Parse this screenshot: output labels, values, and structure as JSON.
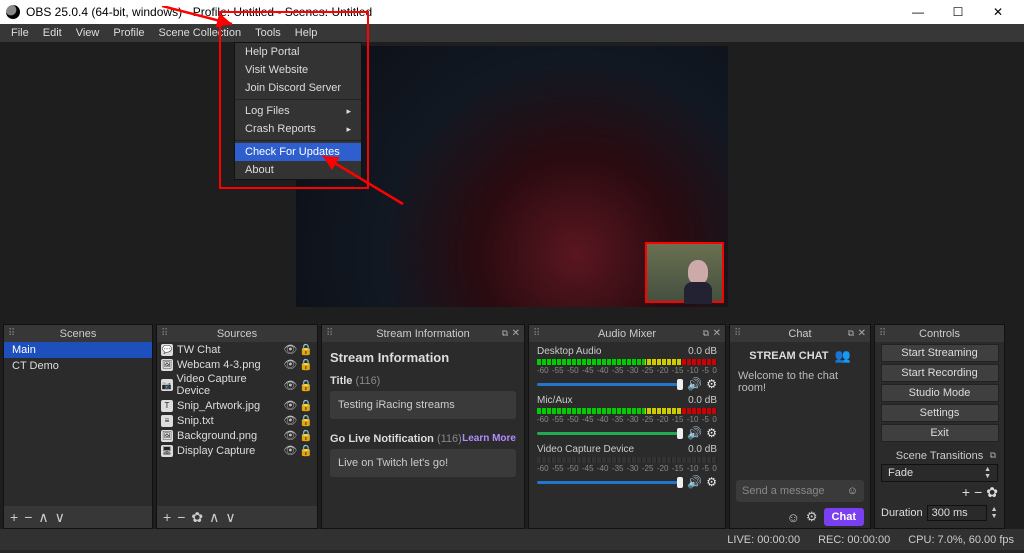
{
  "title": "OBS 25.0.4 (64-bit, windows) - Profile: Untitled - Scenes: Untitled",
  "menus": [
    "File",
    "Edit",
    "View",
    "Profile",
    "Scene Collection",
    "Tools",
    "Help"
  ],
  "help_menu": {
    "items": [
      {
        "label": "Help Portal",
        "sub": false
      },
      {
        "label": "Visit Website",
        "sub": false
      },
      {
        "label": "Join Discord Server",
        "sub": false
      },
      {
        "sep": true
      },
      {
        "label": "Log Files",
        "sub": true
      },
      {
        "label": "Crash Reports",
        "sub": true
      },
      {
        "sep": true
      },
      {
        "label": "Check For Updates",
        "sub": false,
        "highlight": true
      },
      {
        "label": "About",
        "sub": false
      }
    ]
  },
  "docks": {
    "scenes": "Scenes",
    "sources": "Sources",
    "stream_info": "Stream Information",
    "mixer": "Audio Mixer",
    "chat": "Chat",
    "controls": "Controls",
    "transitions": "Scene Transitions"
  },
  "scenes": [
    "Main",
    "CT Demo"
  ],
  "sources": [
    {
      "ico": "💬",
      "name": "TW Chat"
    },
    {
      "ico": "🖼",
      "name": "Webcam 4-3.png"
    },
    {
      "ico": "📷",
      "name": "Video Capture Device"
    },
    {
      "ico": "T",
      "name": "Snip_Artwork.jpg"
    },
    {
      "ico": "≡",
      "name": "Snip.txt"
    },
    {
      "ico": "🖼",
      "name": "Background.png"
    },
    {
      "ico": "🖥",
      "name": "Display Capture"
    }
  ],
  "stream_info": {
    "heading": "Stream Information",
    "title_label": "Title",
    "title_count": "(116)",
    "title_value": "Testing iRacing streams",
    "golive_label": "Go Live Notification",
    "golive_count": "(116)",
    "learn": "Learn More",
    "golive_value": "Live on Twitch let's go!"
  },
  "mixer": {
    "ch": [
      {
        "name": "Desktop Audio",
        "db": "0.0 dB",
        "slider": "blue"
      },
      {
        "name": "Mic/Aux",
        "db": "0.0 dB",
        "slider": "green"
      },
      {
        "name": "Video Capture Device",
        "db": "0.0 dB",
        "slider": "blue"
      }
    ],
    "ticks": [
      "-60",
      "-55",
      "-50",
      "-45",
      "-40",
      "-35",
      "-30",
      "-25",
      "-20",
      "-15",
      "-10",
      "-5",
      "0"
    ]
  },
  "chat": {
    "header": "STREAM CHAT",
    "welcome": "Welcome to the chat room!",
    "placeholder": "Send a message",
    "send": "Chat"
  },
  "controls": {
    "buttons": [
      "Start Streaming",
      "Start Recording",
      "Studio Mode",
      "Settings",
      "Exit"
    ],
    "transition": "Fade",
    "duration_label": "Duration",
    "duration_value": "300 ms"
  },
  "status": {
    "live": "LIVE: 00:00:00",
    "rec": "REC: 00:00:00",
    "cpu": "CPU: 7.0%, 60.00 fps"
  }
}
